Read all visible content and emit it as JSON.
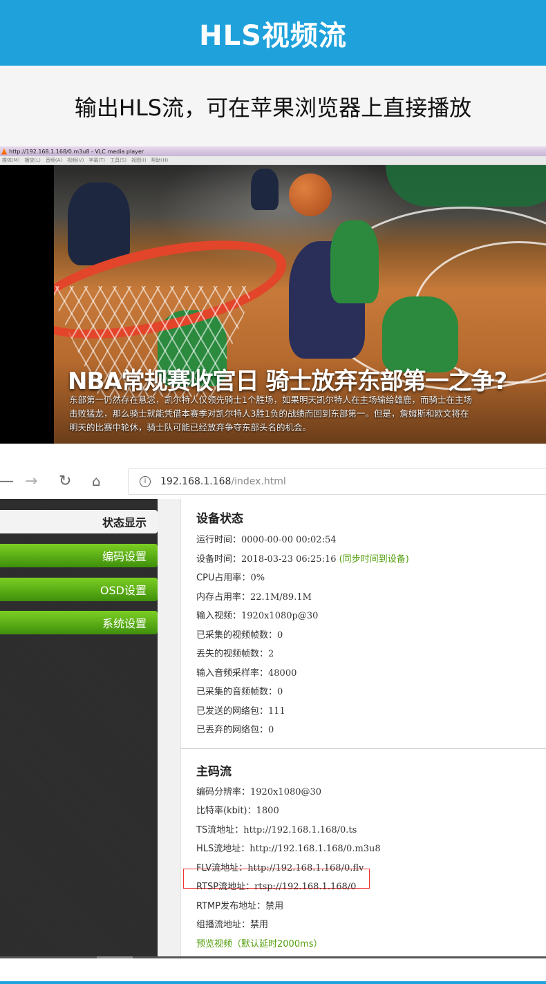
{
  "banner": {
    "title": "HLS视频流"
  },
  "subheading": "输出HLS流，可在苹果浏览器上直接播放",
  "vlc": {
    "title": "http://192.168.1.168/0.m3u8 - VLC media player",
    "menu": [
      "媒体(M)",
      "播放(L)",
      "音频(A)",
      "视频(V)",
      "字幕(T)",
      "工具(S)",
      "视图(I)",
      "帮助(H)"
    ],
    "caption": "NBA常规赛收官日 骑士放弃东部第一之争?",
    "description": "东部第一仍然存在悬念，凯尔特人仅领先骑士1个胜场，如果明天凯尔特人在主场输给雄鹿，而骑士在主场击败猛龙，那么骑士就能凭借本赛季对凯尔特人3胜1负的战绩而回到东部第一。但是，詹姆斯和欧文将在明天的比赛中轮休，骑士队可能已经放弃争夺东部头名的机会。"
  },
  "browser": {
    "url_host": "192.168.1.168",
    "url_path": "/index.html"
  },
  "sidebar": {
    "items": [
      {
        "label": "状态显示"
      },
      {
        "label": "编码设置"
      },
      {
        "label": "OSD设置"
      },
      {
        "label": "系统设置"
      }
    ]
  },
  "device_status": {
    "title": "设备状态",
    "rows": [
      {
        "label": "运行时间：",
        "value": "0000-00-00 00:02:54"
      },
      {
        "label": "设备时间：",
        "value": "2018-03-23 06:25:16",
        "link": "(同步时间到设备)"
      },
      {
        "label": "CPU占用率：",
        "value": "0%"
      },
      {
        "label": "内存占用率：",
        "value": "22.1M/89.1M"
      },
      {
        "label": "输入视频：",
        "value": "1920x1080p@30"
      },
      {
        "label": "已采集的视频帧数：",
        "value": "0"
      },
      {
        "label": "丢失的视频帧数：",
        "value": "2"
      },
      {
        "label": "输入音频采样率：",
        "value": "48000"
      },
      {
        "label": "已采集的音频帧数：",
        "value": "0"
      },
      {
        "label": "已发送的网络包：",
        "value": "111"
      },
      {
        "label": "已丢弃的网络包：",
        "value": "0"
      }
    ]
  },
  "main_stream": {
    "title": "主码流",
    "rows": [
      {
        "label": "编码分辨率：",
        "value": "1920x1080@30"
      },
      {
        "label": "比特率(kbit)：",
        "value": "1800"
      },
      {
        "label": "TS流地址：",
        "value": "http://192.168.1.168/0.ts"
      },
      {
        "label": "HLS流地址：",
        "value": "http://192.168.1.168/0.m3u8"
      },
      {
        "label": "FLV流地址：",
        "value": "http://192.168.1.168/0.flv"
      },
      {
        "label": "RTSP流地址：",
        "value": "rtsp://192.168.1.168/0"
      },
      {
        "label": "RTMP发布地址：",
        "value": "禁用"
      },
      {
        "label": "组播流地址：",
        "value": "禁用"
      }
    ],
    "preview_link": "预览视频（默认延时2000ms）"
  },
  "colors": {
    "banner": "#1fa2dc",
    "accent_green": "#55a00f",
    "highlight": "#ee3333"
  }
}
